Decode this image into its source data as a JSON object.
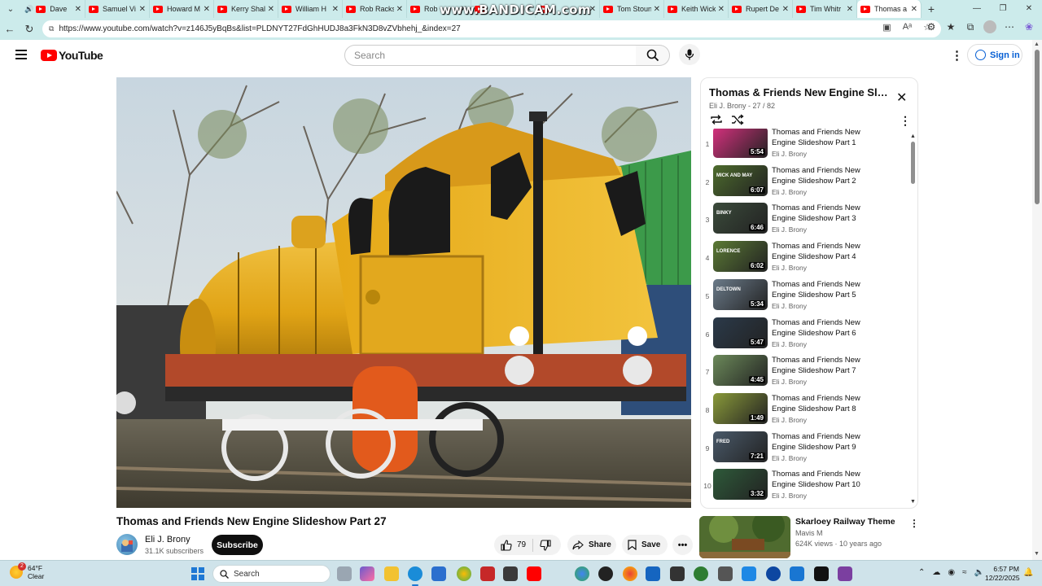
{
  "browser": {
    "overlay_text": "www.BANDICAM.com",
    "tabs": [
      {
        "label": "Dave",
        "audio": true
      },
      {
        "label": "Samuel Vi"
      },
      {
        "label": "Howard M"
      },
      {
        "label": "Kerry Shal"
      },
      {
        "label": "William H"
      },
      {
        "label": "Rob Racks"
      },
      {
        "label": "Rob"
      },
      {
        "label": ""
      },
      {
        "label": ""
      },
      {
        "label": "Tom Stoun"
      },
      {
        "label": "Keith Wick"
      },
      {
        "label": "Rupert De"
      },
      {
        "label": "Tim Whitr"
      },
      {
        "label": "Thomas a",
        "active": true
      }
    ],
    "url": "https://www.youtube.com/watch?v=z146J5yBqBs&list=PLDNYT27FdGhHUDJ8a3FkN3D8vZVbhehj_&index=27"
  },
  "youtube": {
    "logo_text": "YouTube",
    "search_placeholder": "Search",
    "signin_label": "Sign in"
  },
  "video": {
    "title": "Thomas and Friends New Engine Slideshow Part 27",
    "channel": "Eli J. Brony",
    "subscribers": "31.1K subscribers",
    "subscribe_label": "Subscribe",
    "likes": "79",
    "share_label": "Share",
    "save_label": "Save"
  },
  "playlist": {
    "title": "Thomas & Friends New Engine Slide...",
    "subtitle": "Eli J. Brony - 27 / 82",
    "items": [
      {
        "index": "1",
        "title": "Thomas and Friends New Engine Slideshow Part 1",
        "channel": "Eli J. Brony",
        "duration": "5:54",
        "thumb_color": "#d6317e",
        "thumb_text": ""
      },
      {
        "index": "2",
        "title": "Thomas and Friends New Engine Slideshow Part 2",
        "channel": "Eli J. Brony",
        "duration": "6:07",
        "thumb_color": "#4d6b2d",
        "thumb_text": "MICK AND MAY"
      },
      {
        "index": "3",
        "title": "Thomas and Friends New Engine Slideshow Part 3",
        "channel": "Eli J. Brony",
        "duration": "6:46",
        "thumb_color": "#3b4b3b",
        "thumb_text": "BINKY"
      },
      {
        "index": "4",
        "title": "Thomas and Friends New Engine Slideshow Part 4",
        "channel": "Eli J. Brony",
        "duration": "6:02",
        "thumb_color": "#5b7a35",
        "thumb_text": "LORENCE"
      },
      {
        "index": "5",
        "title": "Thomas and Friends New Engine Slideshow Part 5",
        "channel": "Eli J. Brony",
        "duration": "5:34",
        "thumb_color": "#6b7b8a",
        "thumb_text": "DELTOWN"
      },
      {
        "index": "6",
        "title": "Thomas and Friends New Engine Slideshow Part 6",
        "channel": "Eli J. Brony",
        "duration": "5:47",
        "thumb_color": "#2b3a4a",
        "thumb_text": ""
      },
      {
        "index": "7",
        "title": "Thomas and Friends New Engine Slideshow Part 7",
        "channel": "Eli J. Brony",
        "duration": "4:45",
        "thumb_color": "#6c8a5a",
        "thumb_text": ""
      },
      {
        "index": "8",
        "title": "Thomas and Friends New Engine Slideshow Part 8",
        "channel": "Eli J. Brony",
        "duration": "1:49",
        "thumb_color": "#8a9a3a",
        "thumb_text": ""
      },
      {
        "index": "9",
        "title": "Thomas and Friends New Engine Slideshow Part 9",
        "channel": "Eli J. Brony",
        "duration": "7:21",
        "thumb_color": "#4a5a6a",
        "thumb_text": "FRED"
      },
      {
        "index": "10",
        "title": "Thomas and Friends New Engine Slideshow Part 10",
        "channel": "Eli J. Brony",
        "duration": "3:32",
        "thumb_color": "#2e5a3a",
        "thumb_text": ""
      }
    ]
  },
  "recommended": {
    "title": "Skarloey Railway Theme",
    "channel": "Mavis M",
    "meta": "624K views · 10 years ago"
  },
  "taskbar": {
    "badge": "2",
    "temperature": "64°F",
    "condition": "Clear",
    "search_placeholder": "Search",
    "time": "6:57 PM",
    "date": "12/22/2025"
  }
}
